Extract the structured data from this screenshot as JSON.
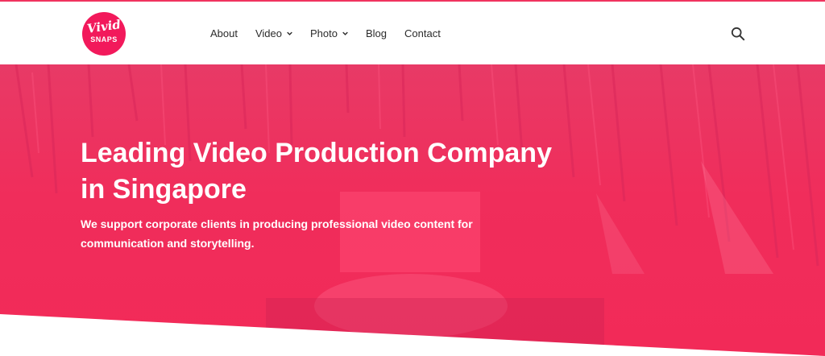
{
  "brand": {
    "logo_line1": "Vivid",
    "logo_line2": "SNAPS",
    "accent_color": "#f2195b"
  },
  "nav": {
    "items": [
      {
        "label": "About",
        "dropdown": false
      },
      {
        "label": "Video",
        "dropdown": true
      },
      {
        "label": "Photo",
        "dropdown": true
      },
      {
        "label": "Blog",
        "dropdown": false
      },
      {
        "label": "Contact",
        "dropdown": false
      }
    ],
    "search_icon": "search-icon"
  },
  "hero": {
    "title": "Leading Video Production Company in Singapore",
    "subtitle": "We support corporate clients in producing professional video content for communication and storytelling.",
    "overlay_color": "#f02d5b"
  }
}
